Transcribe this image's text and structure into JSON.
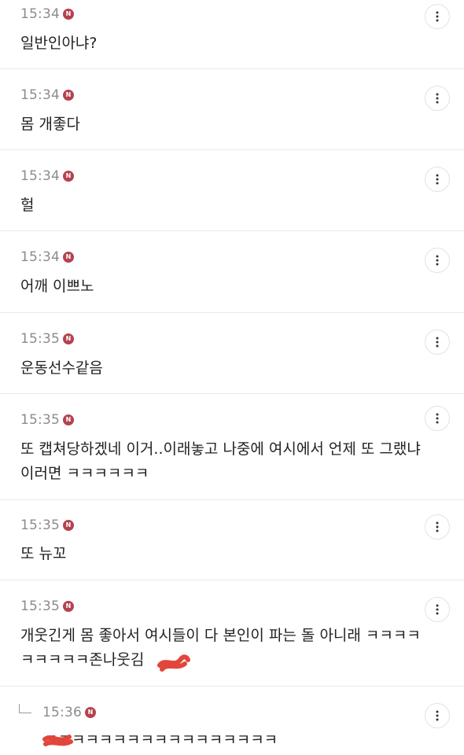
{
  "colors": {
    "badge": "#b5424f",
    "scribble": "#e2463a",
    "divider": "#e9e9e9",
    "time": "#8c8c8c"
  },
  "badge_label": "N",
  "icons": {
    "more": "more-vertical-icon",
    "new": "new-badge-icon",
    "reply": "reply-arrow-icon"
  },
  "comments": [
    {
      "time": "15:34",
      "text": "일반인아냐?"
    },
    {
      "time": "15:34",
      "text": "몸 개좋다"
    },
    {
      "time": "15:34",
      "text": "헐"
    },
    {
      "time": "15:34",
      "text": "어깨 이쁘노"
    },
    {
      "time": "15:35",
      "text": "운동선수같음"
    },
    {
      "time": "15:35",
      "text": "또 캡쳐당하겠네 이거..이래놓고 나중에 여시에서 언제 또 그랬냐 이러면 ㅋㅋㅋㅋㅋㅋ"
    },
    {
      "time": "15:35",
      "text": "또 뉴꼬"
    },
    {
      "time": "15:35",
      "text": "개웃긴게 몸 좋아서 여시들이 다 본인이 파는 돌 아니래 ㅋㅋㅋㅋㅋㅋㅋㅋㅋ존나웃김"
    },
    {
      "time": "15:36",
      "text": "ㅋㅋㅋㅋㅋㅋㅋㅋㅋㅋㅋㅋㅋㅋㅋㅋㅋ",
      "reply": true
    }
  ]
}
